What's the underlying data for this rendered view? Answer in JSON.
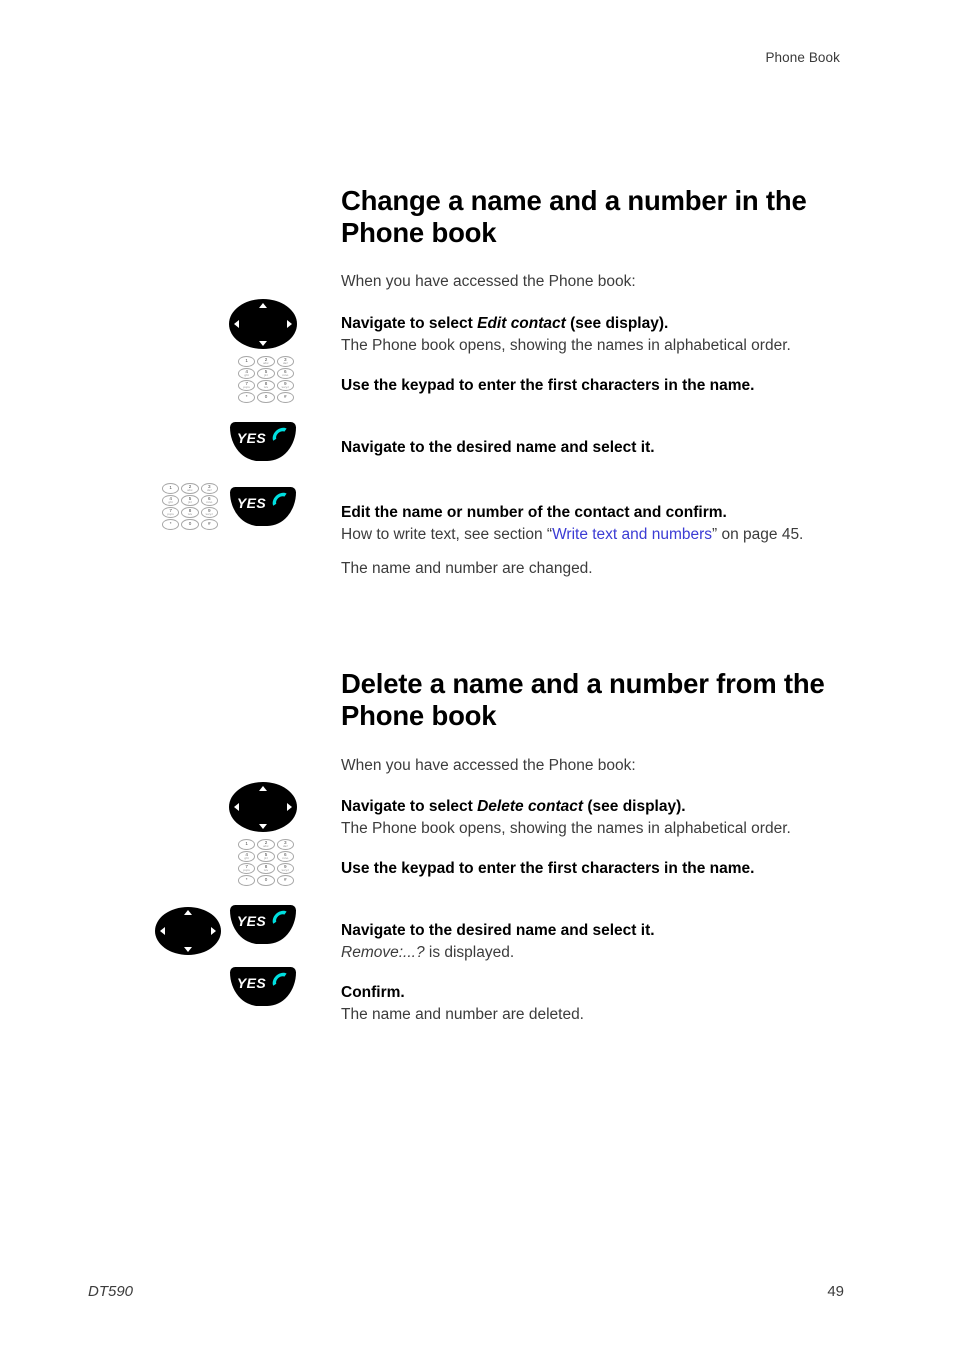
{
  "header": {
    "running_title": "Phone Book"
  },
  "footer": {
    "doc_id": "DT590",
    "page_number": "49"
  },
  "icons": {
    "navigation_key": "navigation-key-icon",
    "yes_key_label": "YES",
    "handset": "phone-handset-icon",
    "keypad": "keypad-icon",
    "keys": [
      {
        "digit": "1",
        "letters": ""
      },
      {
        "digit": "2",
        "letters": "abc"
      },
      {
        "digit": "3",
        "letters": "def"
      },
      {
        "digit": "4",
        "letters": "ghi"
      },
      {
        "digit": "5",
        "letters": "jkl"
      },
      {
        "digit": "6",
        "letters": "mno"
      },
      {
        "digit": "7",
        "letters": "pqrs"
      },
      {
        "digit": "8",
        "letters": "tuv"
      },
      {
        "digit": "9",
        "letters": "wxyz"
      },
      {
        "digit": "*",
        "letters": ""
      },
      {
        "digit": "0",
        "letters": ""
      },
      {
        "digit": "#",
        "letters": ""
      }
    ]
  },
  "colors": {
    "link": "#3b3bd4",
    "handset": "#00e0e0",
    "key_black": "#000000",
    "body_text": "#3c3c3c"
  },
  "sections": [
    {
      "id": "change",
      "title": "Change a name and a number in the Phone book",
      "intro": "When you have accessed the Phone book:",
      "steps": [
        {
          "icon": "navigation-key",
          "lead_before": "Navigate to select ",
          "lead_italic": "Edit contact",
          "lead_after": " (see display).",
          "sub": "The Phone book opens, showing the names in alphabetical order."
        },
        {
          "icon": "keypad",
          "lead_before": "Use the keypad to enter the first characters in the name.",
          "lead_italic": "",
          "lead_after": "",
          "sub": ""
        },
        {
          "icon": "yes-key",
          "lead_before": "Navigate to the desired name and select it.",
          "lead_italic": "",
          "lead_after": "",
          "sub": ""
        },
        {
          "icon": "keypad-and-yes-key",
          "lead_before": "Edit the name or number of the contact and confirm.",
          "lead_italic": "",
          "lead_after": "",
          "sub_before": "How to write text, see section “",
          "sub_link": "Write text and numbers",
          "sub_after": "” on page 45.",
          "para": "The name and number are changed."
        }
      ]
    },
    {
      "id": "delete",
      "title": "Delete a name and a number from the Phone book",
      "intro": "When you have accessed the Phone book:",
      "steps": [
        {
          "icon": "navigation-key",
          "lead_before": "Navigate to select ",
          "lead_italic": "Delete contact",
          "lead_after": " (see display).",
          "sub": "The Phone book opens, showing the names in alphabetical order."
        },
        {
          "icon": "keypad",
          "lead_before": "Use the keypad to enter the first characters in the name.",
          "lead_italic": "",
          "lead_after": "",
          "sub": ""
        },
        {
          "icon": "navigation-key-and-yes-key",
          "lead_before": "Navigate to the desired name and select it.",
          "lead_italic": "",
          "lead_after": "",
          "sub_italic": "Remove:...?",
          "sub_after": " is displayed."
        },
        {
          "icon": "yes-key",
          "lead_before": "Confirm.",
          "lead_italic": "",
          "lead_after": "",
          "sub": "The name and number are deleted."
        }
      ]
    }
  ]
}
